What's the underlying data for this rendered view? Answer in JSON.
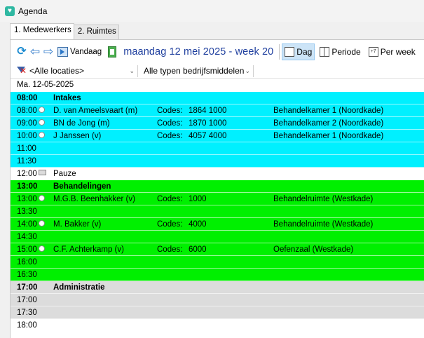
{
  "window": {
    "title": "Agenda"
  },
  "tabs": [
    "1. Medewerkers",
    "2. Ruimtes"
  ],
  "toolbar": {
    "today_label": "Vandaag",
    "date_title": "maandag 12 mei 2025 - week 20",
    "views": [
      {
        "label": "Dag",
        "active": true
      },
      {
        "label": "Periode",
        "active": false
      },
      {
        "label": "Per week",
        "active": false
      }
    ],
    "week_icon_text": "+7"
  },
  "filters": {
    "location": "<Alle locaties>",
    "resource_type": "Alle typen bedrijfsmiddelen"
  },
  "colors": {
    "intake": "#00f0ff",
    "treatment": "#00f000",
    "admin": "#dcdcdc",
    "neutral": "#ffffff"
  },
  "agenda": {
    "date_header": "Ma.  12-05-2025",
    "codes_label": "Codes:",
    "pause_time": "12:00",
    "pause_label": "Pauze",
    "blocks": [
      {
        "time": "08:00",
        "title": "Intakes",
        "color": "intake",
        "rows": [
          {
            "time": "08:00",
            "name": "D. van Ameelsvaart (m)",
            "codes": "1864  1000",
            "location": "Behandelkamer 1 (Noordkade)"
          },
          {
            "time": "09:00",
            "name": "BN de Jong (m)",
            "codes": "1870  1000",
            "location": "Behandelkamer 2 (Noordkade)"
          },
          {
            "time": "10:00",
            "name": "J Janssen (v)",
            "codes": "4057  4000",
            "location": "Behandelkamer 1 (Noordkade)"
          },
          {
            "time": "11:00"
          },
          {
            "time": "11:30"
          }
        ]
      },
      {
        "time": "13:00",
        "title": "Behandelingen",
        "color": "treatment",
        "rows": [
          {
            "time": "13:00",
            "name": "M.G.B. Beenhakker (v)",
            "codes": "1000",
            "location": "Behandelruimte (Westkade)"
          },
          {
            "time": "13:30"
          },
          {
            "time": "14:00",
            "name": "M. Bakker (v)",
            "codes": "4000",
            "location": "Behandelruimte (Westkade)"
          },
          {
            "time": "14:30"
          },
          {
            "time": "15:00",
            "name": "C.F. Achterkamp (v)",
            "codes": "6000",
            "location": "Oefenzaal (Westkade)"
          },
          {
            "time": "16:00"
          },
          {
            "time": "16:30"
          }
        ]
      },
      {
        "time": "17:00",
        "title": "Administratie",
        "color": "admin",
        "rows": [
          {
            "time": "17:00"
          },
          {
            "time": "17:30"
          }
        ]
      }
    ],
    "trailing_time": "18:00"
  }
}
